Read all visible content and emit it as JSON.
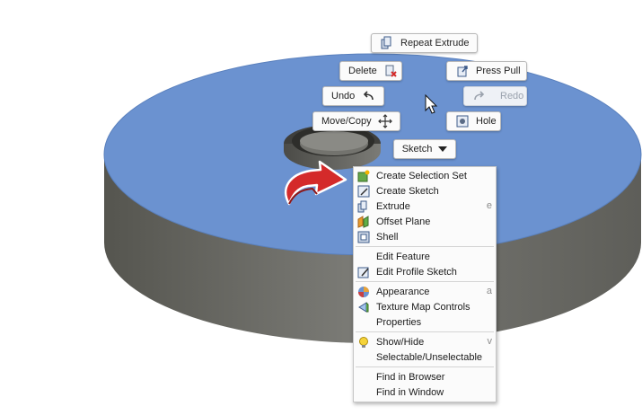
{
  "marking_menu": {
    "repeat_extrude": "Repeat Extrude",
    "delete": "Delete",
    "press_pull": "Press Pull",
    "undo": "Undo",
    "redo": "Redo",
    "move_copy": "Move/Copy",
    "hole": "Hole",
    "sketch": "Sketch"
  },
  "context_menu": {
    "groups": [
      [
        {
          "label": "Create Selection Set",
          "icon": "selection-set-icon"
        },
        {
          "label": "Create Sketch",
          "icon": "sketch-icon"
        },
        {
          "label": "Extrude",
          "icon": "extrude-icon",
          "shortcut": "e"
        },
        {
          "label": "Offset Plane",
          "icon": "offset-plane-icon"
        },
        {
          "label": "Shell",
          "icon": "shell-icon"
        }
      ],
      [
        {
          "label": "Edit Feature"
        },
        {
          "label": "Edit Profile Sketch",
          "icon": "edit-sketch-icon"
        }
      ],
      [
        {
          "label": "Appearance",
          "icon": "appearance-icon",
          "shortcut": "a"
        },
        {
          "label": "Texture Map Controls",
          "icon": "texture-map-icon"
        },
        {
          "label": "Properties"
        }
      ],
      [
        {
          "label": "Show/Hide",
          "icon": "lightbulb-icon",
          "shortcut": "v"
        },
        {
          "label": "Selectable/Unselectable"
        }
      ],
      [
        {
          "label": "Find in Browser"
        },
        {
          "label": "Find in Window"
        }
      ]
    ]
  },
  "colors": {
    "selected_face": "#6b92d0",
    "cylinder_side": "#6e6e69",
    "arrow": "#d42a2a"
  }
}
